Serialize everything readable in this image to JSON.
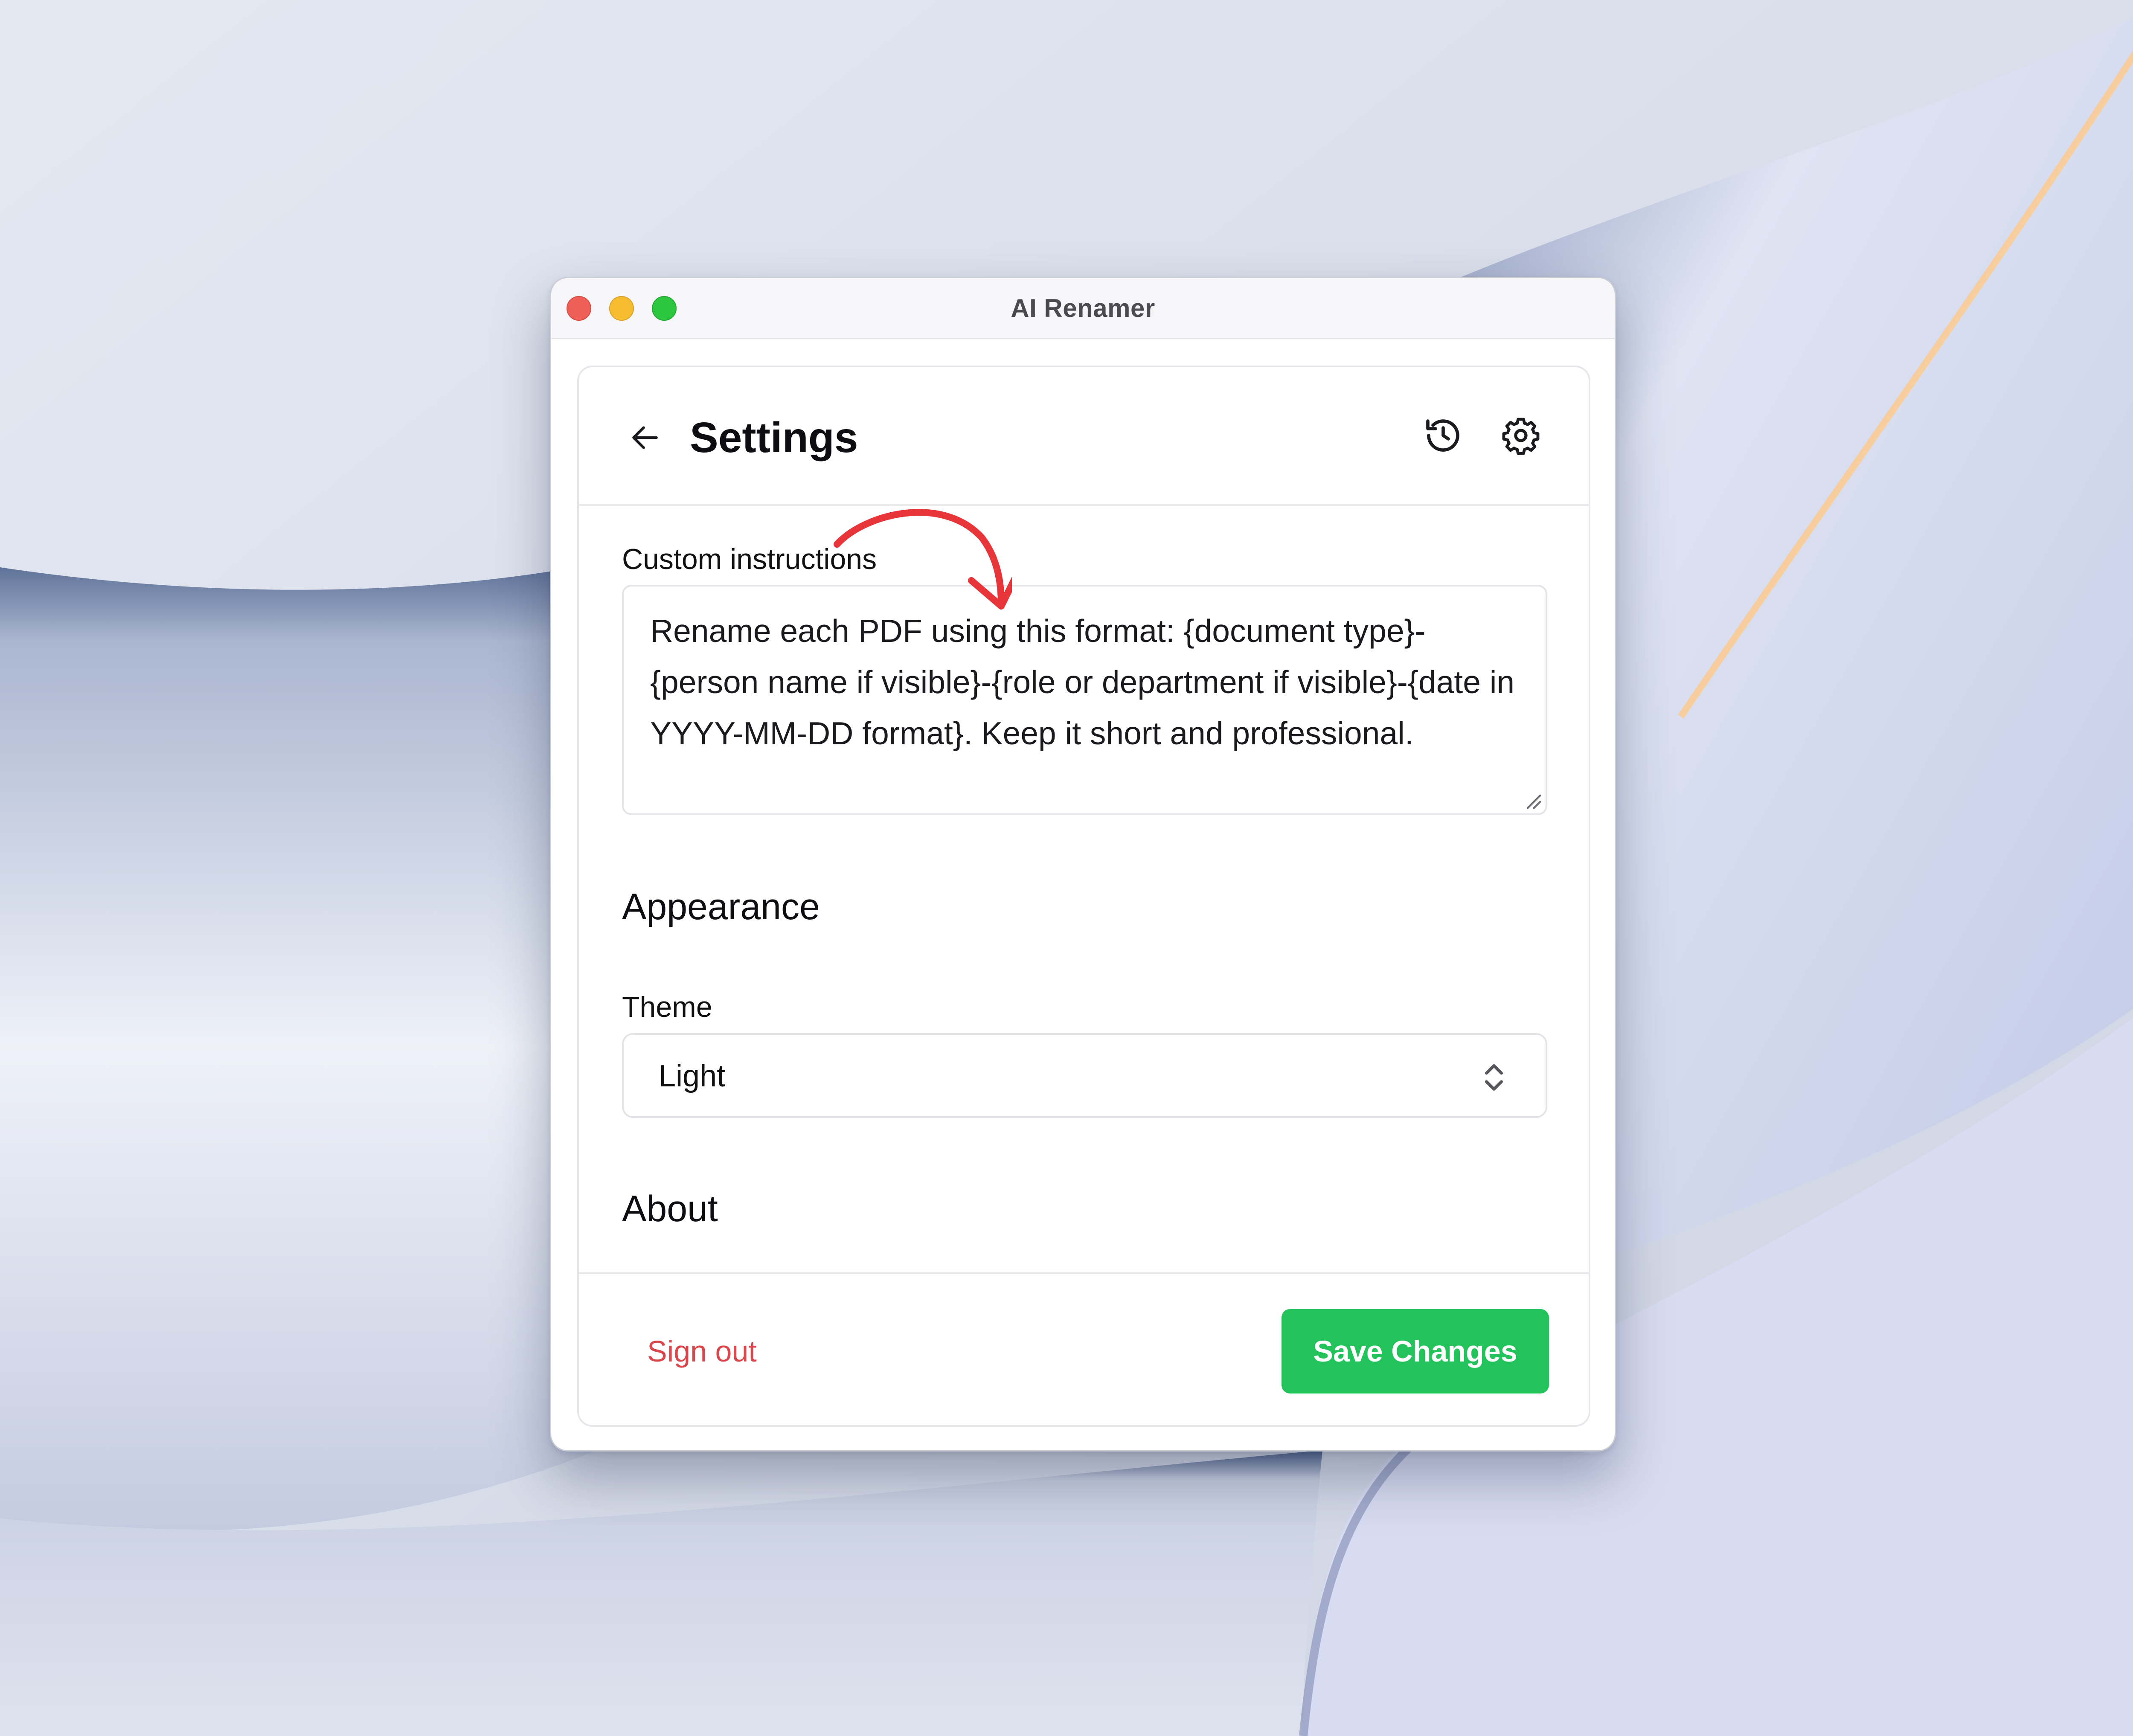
{
  "window": {
    "title": "AI Renamer"
  },
  "header": {
    "title": "Settings",
    "back_icon": "arrow-left-icon",
    "history_icon": "history-icon",
    "settings_icon": "gear-icon"
  },
  "custom_instructions": {
    "label": "Custom instructions",
    "value": "Rename each PDF using this format: {document type}-{person name if visible}-{role or department if visible}-{date in YYYY-MM-DD format}. Keep it short and professional."
  },
  "appearance": {
    "heading": "Appearance",
    "theme_label": "Theme",
    "theme_value": "Light",
    "select_icon": "chevron-up-down-icon"
  },
  "about": {
    "heading": "About"
  },
  "footer": {
    "signout_label": "Sign out",
    "save_label": "Save Changes"
  },
  "colors": {
    "accent_green": "#22c35b",
    "danger_red": "#d9474c",
    "annotation_red": "#e8353a"
  }
}
